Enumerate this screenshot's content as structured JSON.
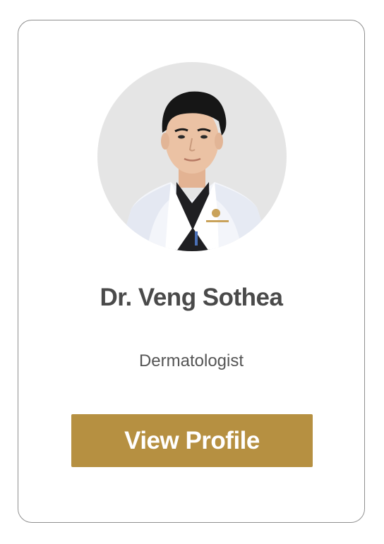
{
  "card": {
    "avatar_alt": "Dr. Veng Sothea",
    "name": "Dr. Veng Sothea",
    "specialty": "Dermatologist",
    "button_label": "View Profile"
  },
  "colors": {
    "accent": "#b69041",
    "name_text": "#4a4a4a",
    "card_border": "#8f8f8f",
    "avatar_bg": "#e5e5e5"
  }
}
